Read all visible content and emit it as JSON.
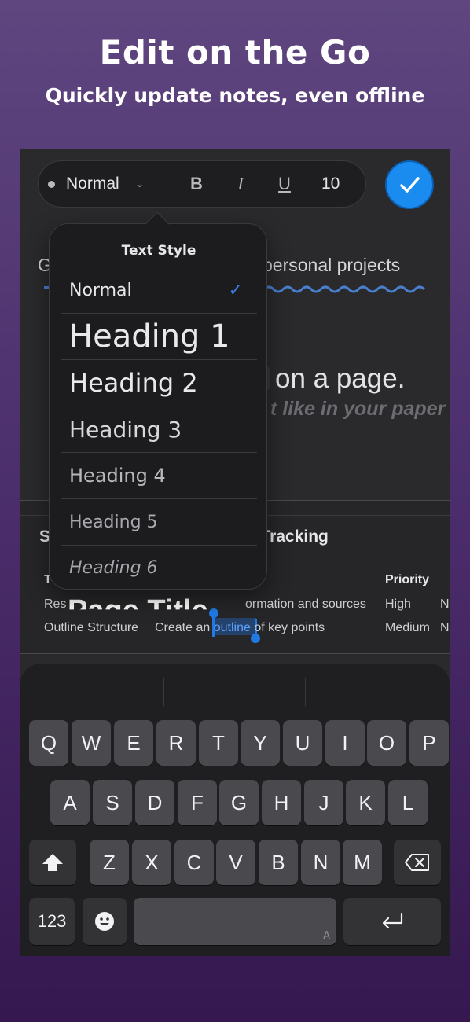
{
  "hero": {
    "title": "Edit on the Go",
    "subtitle": "Quickly update notes, even offline"
  },
  "toolbar": {
    "style_value": "Normal",
    "bold_label": "B",
    "italic_label": "I",
    "underline_label": "U",
    "font_size": "10"
  },
  "popover": {
    "title": "Text Style",
    "options": [
      "Normal",
      "Heading 1",
      "Heading 2",
      "Heading 3",
      "Heading 4",
      "Heading 5",
      "Heading 6"
    ],
    "selected": "Normal"
  },
  "document": {
    "frag_left": "G",
    "frag_right": "personal projects",
    "frag_page": "on a page.",
    "frag_italic": "t like in your paper n",
    "table_title_left": "S",
    "table_title_right": "k Tracking",
    "col_priority": "Priority",
    "col_left_letter": "T",
    "row1": {
      "c1": "Res",
      "c2": "ormation and sources",
      "c3": "High",
      "c4": "N"
    },
    "row2": {
      "c1": "Outline Structure",
      "c2a": "Create an ",
      "c2b": "outline",
      "c2c": " of key points",
      "c3": "Medium",
      "c4": "N"
    },
    "page_title_partial": "Page Title"
  },
  "keyboard": {
    "row1": [
      "Q",
      "W",
      "E",
      "R",
      "T",
      "Y",
      "U",
      "I",
      "O",
      "P"
    ],
    "row2": [
      "A",
      "S",
      "D",
      "F",
      "G",
      "H",
      "J",
      "K",
      "L"
    ],
    "row3": [
      "Z",
      "X",
      "C",
      "V",
      "B",
      "N",
      "M"
    ],
    "numbers_label": "123",
    "space_marker": "A"
  },
  "colors": {
    "accent": "#1a8cf0",
    "check": "#3d7fe6"
  }
}
